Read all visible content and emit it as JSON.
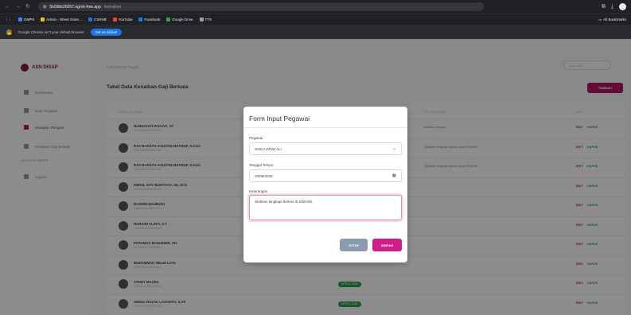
{
  "browser": {
    "url_host": "5b09bb26057.ngrok-free.app",
    "url_path": "/kenaikan",
    "bookmarks": [
      {
        "label": "GMPS",
        "color": "#4285f4"
      },
      {
        "label": "Admin - Sheet Gram...",
        "color": "#fbbc05"
      },
      {
        "label": "CSRNB",
        "color": "#1a73e8"
      },
      {
        "label": "YouTube",
        "color": "#ea4335"
      },
      {
        "label": "Facebook",
        "color": "#1877f2"
      },
      {
        "label": "Google Drive",
        "color": "#34a853"
      },
      {
        "label": "TTS",
        "color": "#9aa0a6"
      }
    ],
    "bookmarks_right": "All Bookmarks",
    "infobar_text": "Google Chrome isn't your default browser",
    "infobar_button": "Set as default"
  },
  "sidebar": {
    "brand": "ASN DISAP",
    "items": [
      {
        "label": "Dashboard",
        "active": false
      },
      {
        "label": "Data Pegawai",
        "active": false
      },
      {
        "label": "Kenaikan Pangkat",
        "active": true
      },
      {
        "label": "Kenaikan Gaji Berkala",
        "active": false
      }
    ],
    "section": "ACCOUNT PAGES",
    "logout": "Logout"
  },
  "main": {
    "breadcrumb": "ASN DISAP / Pages",
    "search_placeholder": "Type here...",
    "title": "Tabel Data Kenaikan Gaji Berkala",
    "add_button": "TAMBAH",
    "columns": [
      "NAMA PEGAWAI",
      "STATUS",
      "KETERANGAN",
      "AKSI"
    ],
    "rows": [
      {
        "name": "NURHAYATI PAKAYA, ST",
        "nip": "197101231998032001",
        "status": "",
        "keterangan": "Berkas Lengkap"
      },
      {
        "name": "RAS BAHAYU AGUSTIN MAARUF, S.Kom",
        "nip": "198408152009012001",
        "status": "",
        "keterangan": "Silahkan lengkapi berkas pada SIMASN"
      },
      {
        "name": "RAS BAHAYU AGUSTIN MAARUF, S.Kom",
        "nip": "198408152009012001",
        "status": "",
        "keterangan": "Silahkan lengkapi berkas pada SIMASN"
      },
      {
        "name": "ISMAIL SITY BUNTOYO, SE, M.Si",
        "nip": "197404052001011004",
        "status": "",
        "keterangan": ""
      },
      {
        "name": "RASMIN MAHMUDI",
        "nip": "196608151990031003",
        "status": "",
        "keterangan": ""
      },
      {
        "name": "NURAINI ALINTI, S.T",
        "nip": "197604192010012004",
        "status": "",
        "keterangan": ""
      },
      {
        "name": "PARAMAS BAGUENIR, SH",
        "nip": "197003121993032004",
        "status": "",
        "keterangan": ""
      },
      {
        "name": "MUHAMMAD HELMI LAYA",
        "nip": "198503202007011003",
        "status": "",
        "keterangan": ""
      },
      {
        "name": "JOHNY MAURA",
        "nip": "196811091989031013",
        "status": "SPROL 2025",
        "keterangan": ""
      },
      {
        "name": "ABDUL RAZAK LASANTO, S.AP",
        "nip": "196604231988031006",
        "status": "SPROL 2025",
        "keterangan": ""
      }
    ],
    "edit_label": "EDIT",
    "delete_label": "HAPUS"
  },
  "modal": {
    "title": "Form Input Pegawai",
    "pegawai_label": "Pegawai",
    "pegawai_value": "SISKA DEWI ALI",
    "tanggal_label": "Tanggal Tempo",
    "tanggal_value": "20/08/2025",
    "keterangan_label": "Keterangan",
    "keterangan_value": "silahkan lengkapi berkas di SIMASN",
    "close_button": "TUTUP",
    "save_button": "SIMPAN"
  },
  "colors": {
    "accent": "#b4185f",
    "save": "#d11d8a",
    "close": "#8a9bb0",
    "status_green": "#2e9e53"
  }
}
